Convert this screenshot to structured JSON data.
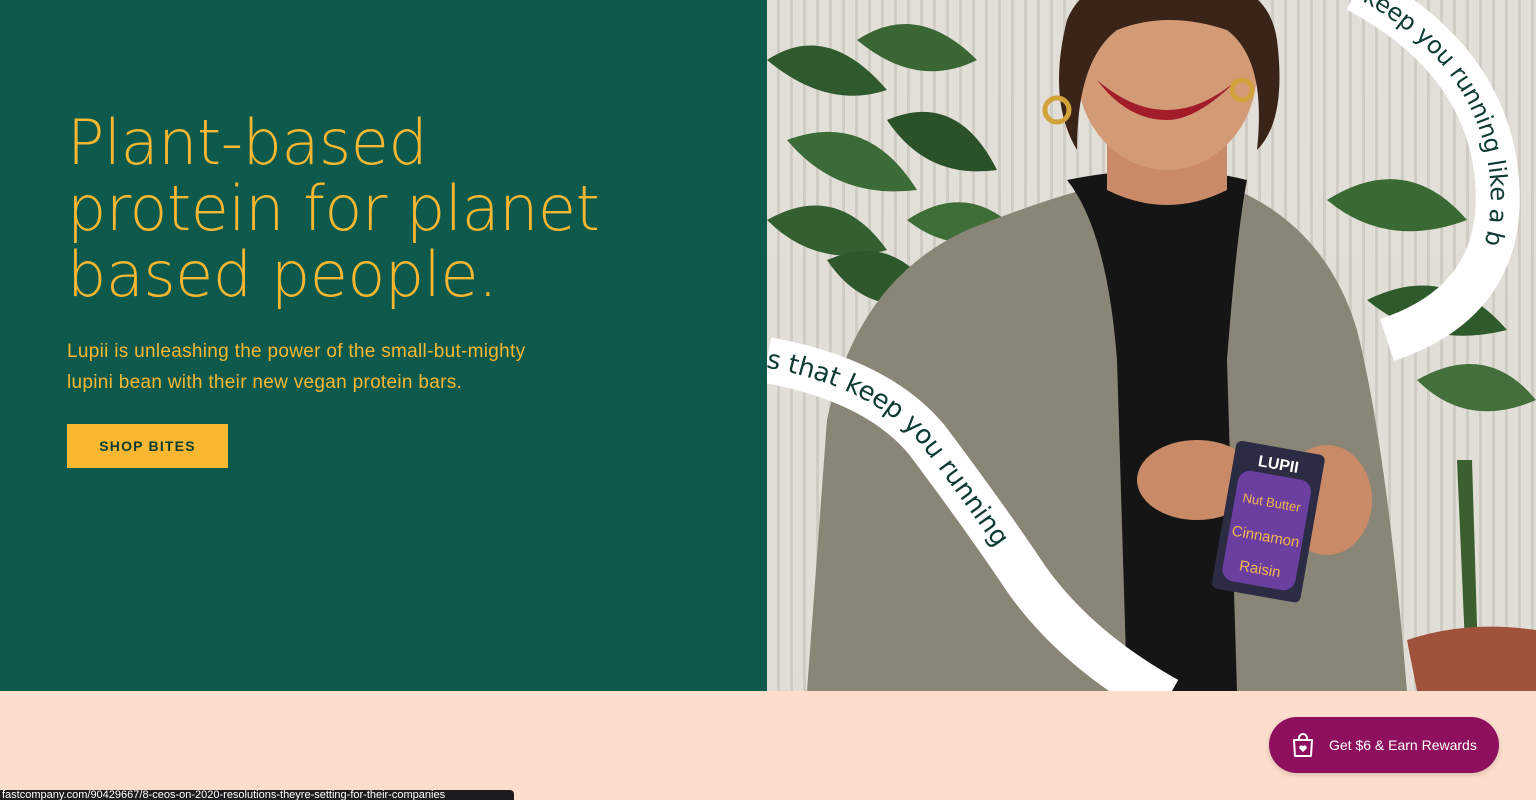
{
  "hero": {
    "headline_line1": "Plant-based",
    "headline_line2": "protein for planet",
    "headline_line3": "based people.",
    "subtext_line1": "Lupii is unleashing the power of the small-but-mighty",
    "subtext_line2": "lupini bean with their new vegan protein bars.",
    "shop_button": "SHOP BITES",
    "ribbon_text_top": "keep you running like a b",
    "ribbon_text_bottom": "s that keep you running",
    "product": {
      "brand": "LUPII",
      "flavor_line1": "Nut Butter",
      "flavor_line2": "Cinnamon",
      "flavor_line3": "Raisin"
    }
  },
  "rewards": {
    "label": "Get $6 & Earn Rewards",
    "icon": "shopping-bag-heart-icon"
  },
  "status_bar": {
    "url": "fastcompany.com/90429667/8-ceos-on-2020-resolutions-theyre-setting-for-their-companies"
  },
  "colors": {
    "hero_green": "#0D5A4C",
    "accent_yellow": "#F7B731",
    "page_peach": "#FDDDCB",
    "rewards_magenta": "#8E0F5E"
  }
}
